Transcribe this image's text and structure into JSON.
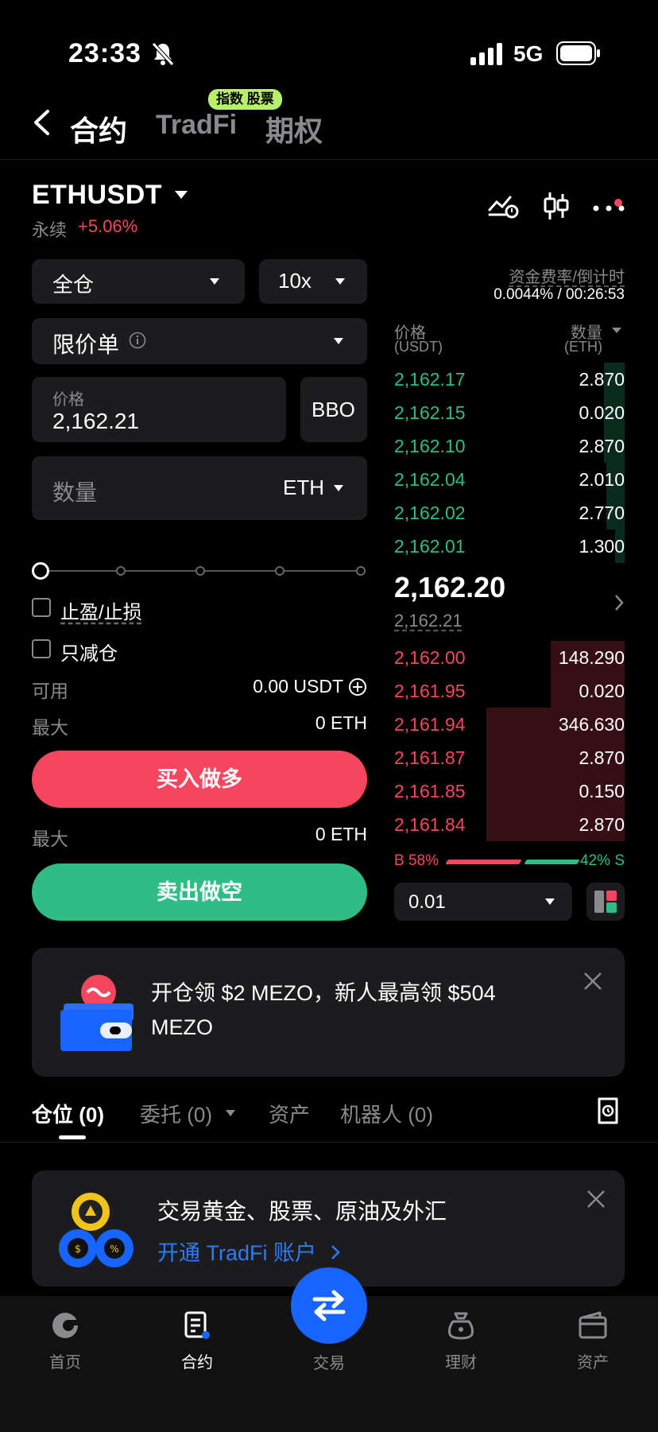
{
  "status": {
    "time": "23:33",
    "network": "5G"
  },
  "header": {
    "tabs": [
      "合约",
      "TradFi",
      "期权"
    ],
    "tradfi_badge": "指数 股票"
  },
  "symbol": {
    "name": "ETHUSDT",
    "type": "永续",
    "change": "+5.06%"
  },
  "order_form": {
    "margin_mode": "全仓",
    "leverage": "10x",
    "order_type": "限价单",
    "price_label": "价格",
    "price_value": "2,162.21",
    "bbo": "BBO",
    "qty_placeholder": "数量",
    "qty_unit": "ETH",
    "tp_sl": "止盈/止损",
    "reduce_only": "只减仓",
    "available_label": "可用",
    "available_value": "0.00 USDT",
    "max_label": "最大",
    "max_buy": "0 ETH",
    "max_sell": "0 ETH",
    "buy_label": "买入做多",
    "sell_label": "卖出做空",
    "slider_stops": 5,
    "slider_value": 0
  },
  "funding": {
    "label": "资金费率/倒计时",
    "value": "0.0044% / 00:26:53"
  },
  "orderbook": {
    "price_header": "价格",
    "price_unit": "(USDT)",
    "qty_header": "数量",
    "qty_unit": "(ETH)",
    "bids": [
      {
        "price": "2,162.17",
        "qty": "2.870",
        "depth": 0.09
      },
      {
        "price": "2,162.15",
        "qty": "0.020",
        "depth": 0.09
      },
      {
        "price": "2,162.10",
        "qty": "2.870",
        "depth": 0.09
      },
      {
        "price": "2,162.04",
        "qty": "2.010",
        "depth": 0.08
      },
      {
        "price": "2,162.02",
        "qty": "2.770",
        "depth": 0.08
      },
      {
        "price": "2,162.01",
        "qty": "1.300",
        "depth": 0.04
      }
    ],
    "last_price": "2,162.20",
    "mark_price": "2,162.21",
    "asks": [
      {
        "price": "2,162.00",
        "qty": "148.290",
        "depth": 0.32
      },
      {
        "price": "2,161.95",
        "qty": "0.020",
        "depth": 0.32
      },
      {
        "price": "2,161.94",
        "qty": "346.630",
        "depth": 0.6
      },
      {
        "price": "2,161.87",
        "qty": "2.870",
        "depth": 0.6
      },
      {
        "price": "2,161.85",
        "qty": "0.150",
        "depth": 0.6
      },
      {
        "price": "2,161.84",
        "qty": "2.870",
        "depth": 0.6
      }
    ],
    "buy_ratio": "B 58%",
    "sell_ratio": "42% S",
    "buy_pct": 58,
    "precision": "0.01"
  },
  "promo": {
    "text": "开仓领 $2 MEZO，新人最高领 $504 MEZO"
  },
  "positions_tabs": [
    "仓位 (0)",
    "委托 (0)",
    "资产",
    "机器人 (0)"
  ],
  "tradfi_card": {
    "title": "交易黄金、股票、原油及外汇",
    "link": "开通 TradFi 账户"
  },
  "bottom_nav": [
    "首页",
    "合约",
    "交易",
    "理财",
    "资产"
  ],
  "colors": {
    "buy": "#2ebd85",
    "sell": "#f6465d",
    "accent": "#1764ff",
    "badge": "#b9f06b"
  }
}
